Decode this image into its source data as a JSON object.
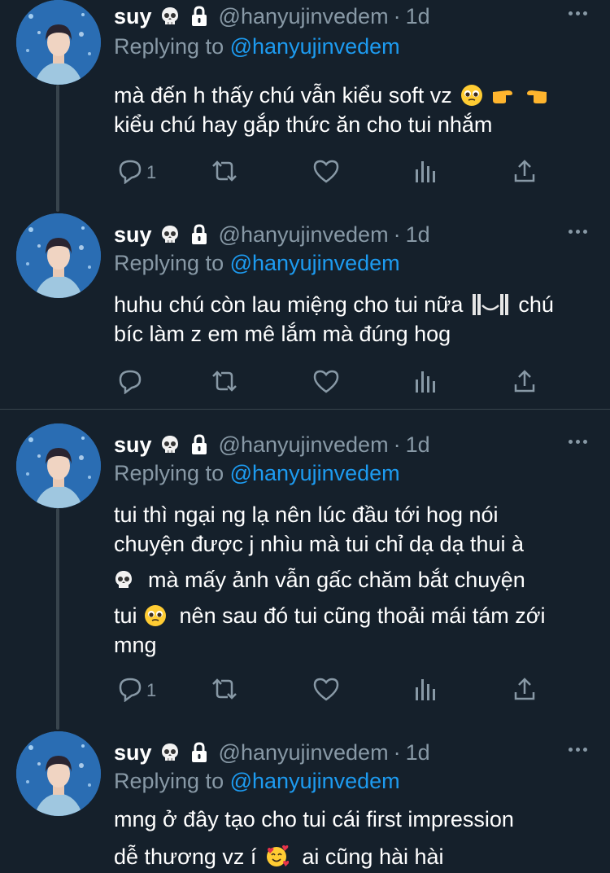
{
  "tweets": [
    {
      "name": "suy",
      "handle": "@hanyujinvedem",
      "separator": "·",
      "time": "1d",
      "replying_prefix": "Replying to",
      "replying_to": "@hanyujinvedem",
      "lines": [
        "mà đến h thấy chú vẫn kiểu soft vz",
        "kiểu chú hay gắp thức ăn cho tui nhắm"
      ],
      "reply_count": "1"
    },
    {
      "name": "suy",
      "handle": "@hanyujinvedem",
      "separator": "·",
      "time": "1d",
      "replying_prefix": "Replying to",
      "replying_to": "@hanyujinvedem",
      "lines": [
        "huhu chú còn lau miệng cho tui nữa",
        "chú",
        "bíc làm z em mê lắm mà đúng hog"
      ],
      "reply_count": ""
    },
    {
      "name": "suy",
      "handle": "@hanyujinvedem",
      "separator": "·",
      "time": "1d",
      "replying_prefix": "Replying to",
      "replying_to": "@hanyujinvedem",
      "lines": [
        "tui thì ngại ng lạ nên lúc đầu tới hog nói",
        "chuyện được j nhìu mà tui chỉ dạ dạ thui à",
        "mà mấy ảnh vẫn gấc chăm bắt chuyện",
        "tui",
        "nên sau đó tui cũng thoải mái tám zới",
        "mng"
      ],
      "reply_count": "1"
    },
    {
      "name": "suy",
      "handle": "@hanyujinvedem",
      "separator": "·",
      "time": "1d",
      "replying_prefix": "Replying to",
      "replying_to": "@hanyujinvedem",
      "lines": [
        "mng ở đây tạo cho tui cái first impression",
        "dễ thương vz í",
        "ai cũng hài hài"
      ],
      "reply_count": ""
    }
  ],
  "icons": {
    "avatar": "profile-photo",
    "name_emoji": "skull",
    "protected": "lock-icon",
    "reply": "reply-icon",
    "retweet": "retweet-icon",
    "like": "heart-icon",
    "analytics": "analytics-icon",
    "share": "share-icon",
    "more": "more-icon"
  },
  "colors": {
    "background": "#15202b",
    "text": "#ffffff",
    "secondary": "#8899a6",
    "link": "#1d9bf0",
    "divider": "#38444d"
  }
}
